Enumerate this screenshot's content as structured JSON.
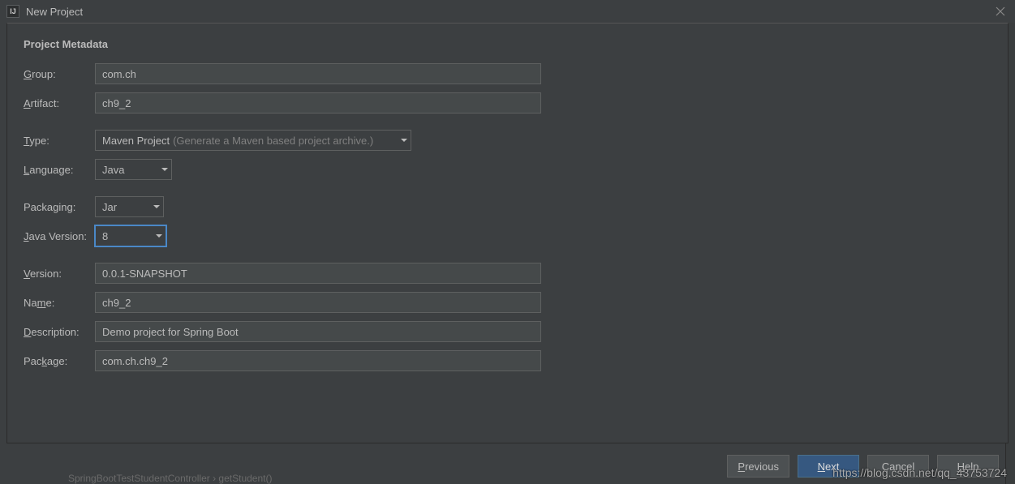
{
  "window": {
    "title": "New Project",
    "icon_label": "IJ"
  },
  "section_title": "Project Metadata",
  "fields": {
    "group": {
      "label_pre": "",
      "label_mn": "G",
      "label_post": "roup:",
      "value": "com.ch"
    },
    "artifact": {
      "label_pre": "",
      "label_mn": "A",
      "label_post": "rtifact:",
      "value": "ch9_2"
    },
    "type": {
      "label_pre": "",
      "label_mn": "T",
      "label_post": "ype:",
      "value": "Maven Project",
      "hint": "(Generate a Maven based project archive.)"
    },
    "language": {
      "label_pre": "",
      "label_mn": "L",
      "label_post": "anguage:",
      "value": "Java"
    },
    "packaging": {
      "label_pre": "Packaging:",
      "value": "Jar"
    },
    "javaversion": {
      "label_pre": "",
      "label_mn": "J",
      "label_post": "ava Version:",
      "value": "8"
    },
    "version": {
      "label_pre": "",
      "label_mn": "V",
      "label_post": "ersion:",
      "value": "0.0.1-SNAPSHOT"
    },
    "name": {
      "label_pre": "Na",
      "label_mn": "m",
      "label_post": "e:",
      "value": "ch9_2"
    },
    "description": {
      "label_pre": "",
      "label_mn": "D",
      "label_post": "escription:",
      "value": "Demo project for Spring Boot"
    },
    "package": {
      "label_pre": "Pac",
      "label_mn": "k",
      "label_post": "age:",
      "value": "com.ch.ch9_2"
    }
  },
  "buttons": {
    "previous": {
      "pre": "",
      "mn": "P",
      "post": "revious"
    },
    "next": {
      "pre": "",
      "mn": "N",
      "post": "ext"
    },
    "cancel": {
      "label": "Cancel"
    },
    "help": {
      "pre": "",
      "mn": "H",
      "post": "elp"
    }
  },
  "watermark": "https://blog.csdn.net/qq_43753724",
  "bg_text": "SpringBootTestStudentController    ›    getStudent()"
}
